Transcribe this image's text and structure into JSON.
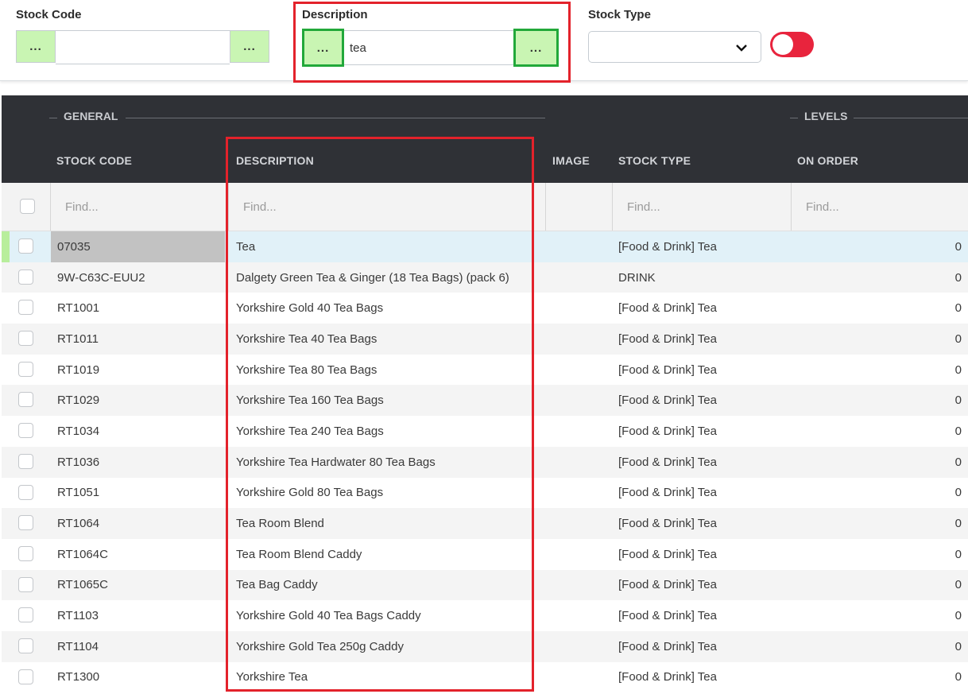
{
  "filters": {
    "stock_code": {
      "label": "Stock Code",
      "value": "",
      "button_label": "..."
    },
    "description": {
      "label": "Description",
      "value": "tea",
      "button_label": "..."
    },
    "stock_type": {
      "label": "Stock Type",
      "value": ""
    },
    "toggle": {
      "state": "off",
      "color": "#e8243d"
    }
  },
  "grid": {
    "groups": {
      "general": "GENERAL",
      "levels": "LEVELS"
    },
    "columns": {
      "stock_code": "STOCK CODE",
      "description": "DESCRIPTION",
      "image": "IMAGE",
      "stock_type": "STOCK TYPE",
      "on_order": "ON ORDER"
    },
    "find_placeholder": "Find...",
    "rows": [
      {
        "code": "07035",
        "description": "Tea",
        "stock_type": "[Food & Drink] Tea",
        "on_order": "0"
      },
      {
        "code": "9W-C63C-EUU2",
        "description": "Dalgety Green Tea & Ginger (18 Tea Bags) (pack 6)",
        "stock_type": "DRINK",
        "on_order": "0"
      },
      {
        "code": "RT1001",
        "description": "Yorkshire Gold 40 Tea Bags",
        "stock_type": "[Food & Drink] Tea",
        "on_order": "0"
      },
      {
        "code": "RT1011",
        "description": "Yorkshire Tea 40 Tea Bags",
        "stock_type": "[Food & Drink] Tea",
        "on_order": "0"
      },
      {
        "code": "RT1019",
        "description": "Yorkshire Tea 80 Tea Bags",
        "stock_type": "[Food & Drink] Tea",
        "on_order": "0"
      },
      {
        "code": "RT1029",
        "description": "Yorkshire Tea 160 Tea Bags",
        "stock_type": "[Food & Drink] Tea",
        "on_order": "0"
      },
      {
        "code": "RT1034",
        "description": "Yorkshire Tea 240 Tea Bags",
        "stock_type": "[Food & Drink] Tea",
        "on_order": "0"
      },
      {
        "code": "RT1036",
        "description": "Yorkshire Tea Hardwater 80 Tea Bags",
        "stock_type": "[Food & Drink] Tea",
        "on_order": "0"
      },
      {
        "code": "RT1051",
        "description": "Yorkshire Gold 80 Tea Bags",
        "stock_type": "[Food & Drink] Tea",
        "on_order": "0"
      },
      {
        "code": "RT1064",
        "description": "Tea Room Blend",
        "stock_type": "[Food & Drink] Tea",
        "on_order": "0"
      },
      {
        "code": "RT1064C",
        "description": "Tea Room Blend Caddy",
        "stock_type": "[Food & Drink] Tea",
        "on_order": "0"
      },
      {
        "code": "RT1065C",
        "description": "Tea Bag Caddy",
        "stock_type": "[Food & Drink] Tea",
        "on_order": "0"
      },
      {
        "code": "RT1103",
        "description": "Yorkshire Gold 40 Tea Bags Caddy",
        "stock_type": "[Food & Drink] Tea",
        "on_order": "0"
      },
      {
        "code": "RT1104",
        "description": "Yorkshire Gold Tea 250g Caddy",
        "stock_type": "[Food & Drink] Tea",
        "on_order": "0"
      },
      {
        "code": "RT1300",
        "description": "Yorkshire Tea",
        "stock_type": "[Food & Drink] Tea",
        "on_order": "0"
      }
    ]
  },
  "highlight_colors": {
    "red": "#e3222b",
    "green": "#22a83a",
    "button_fill": "#c9f5b3"
  },
  "icons": {
    "dropdown": "chevron-down-icon"
  }
}
